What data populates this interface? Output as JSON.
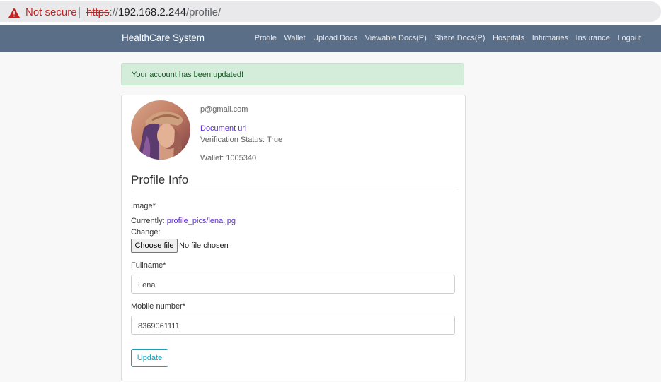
{
  "browser": {
    "security_label": "Not secure",
    "url_scheme": "https",
    "url_sep": "://",
    "url_host": "192.168.2.244",
    "url_path": "/profile/"
  },
  "navbar": {
    "brand": "HealthCare System",
    "links": [
      "Profile",
      "Wallet",
      "Upload Docs",
      "Viewable Docs(P)",
      "Share Docs(P)",
      "Hospitals",
      "Infirmaries",
      "Insurance",
      "Logout"
    ]
  },
  "alert": {
    "message": "Your account has been updated!"
  },
  "profile": {
    "email": "p@gmail.com",
    "document_link": "Document url",
    "verification": "Verification Status: True",
    "wallet": "Wallet: 1005340"
  },
  "form": {
    "title": "Profile Info",
    "image_label": "Image*",
    "currently_label": "Currently: ",
    "currently_file": "profile_pics/lena.jpg",
    "change_label": "Change:",
    "choose_file": "Choose file",
    "no_file": "No file chosen",
    "fullname_label": "Fullname*",
    "fullname_value": "Lena",
    "mobile_label": "Mobile number*",
    "mobile_value": "8369061111",
    "submit": "Update"
  },
  "colors": {
    "navbar": "#5b6e88",
    "alert_bg": "#d4edda",
    "update_button": "#17a2b8",
    "link": "#5a2bd6",
    "not_secure": "#c5221f"
  }
}
